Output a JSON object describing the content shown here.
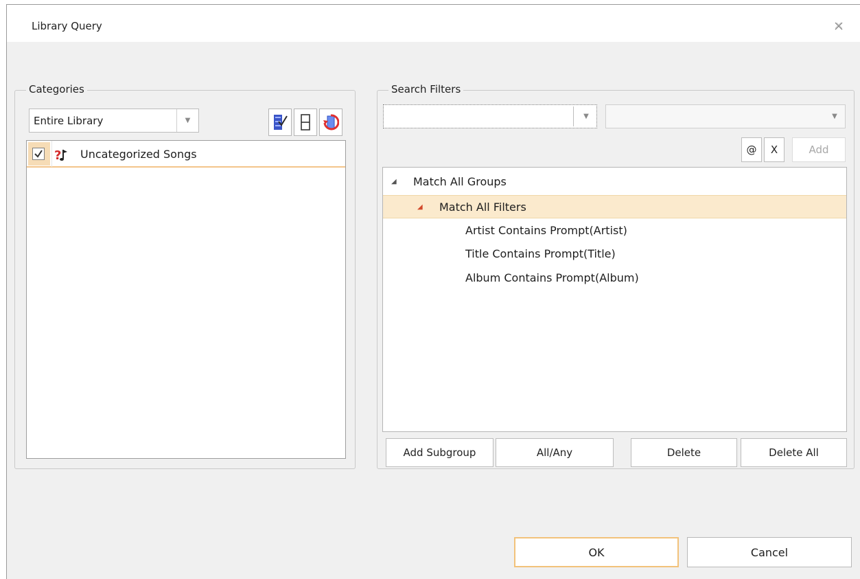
{
  "window": {
    "title": "Library Query"
  },
  "categories": {
    "legend": "Categories",
    "library_combo": {
      "selected": "Entire Library"
    },
    "items": [
      {
        "label": "Uncategorized Songs",
        "checked": true
      }
    ]
  },
  "search_filters": {
    "legend": "Search Filters",
    "field_combo": {
      "selected": ""
    },
    "operator_combo": {
      "selected": ""
    },
    "at_label": "@",
    "x_label": "X",
    "add_label": "Add",
    "tree": {
      "root": "Match All Groups",
      "group": "Match All Filters",
      "filters": [
        "Artist Contains Prompt(Artist)",
        "Title Contains Prompt(Title)",
        "Album Contains Prompt(Album)"
      ]
    },
    "buttons": {
      "add_subgroup": "Add Subgroup",
      "all_any": "All/Any",
      "delete": "Delete",
      "delete_all": "Delete All"
    }
  },
  "dialog_buttons": {
    "ok": "OK",
    "cancel": "Cancel"
  },
  "colors": {
    "accent_highlight": "#fbeacd",
    "accent_border": "#f2c27a",
    "triangle_red": "#d24a2c"
  }
}
